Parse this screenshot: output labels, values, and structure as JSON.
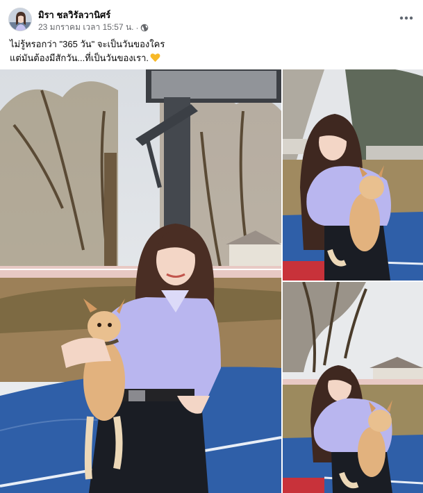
{
  "post": {
    "author": "มิรา ชลวิรัลวานิศร์",
    "timestamp": "23 มกราคม เวลา 15:57 น.",
    "separator": "·",
    "privacy_icon": "globe-icon",
    "more_icon": "more-horizontal-icon"
  },
  "caption": {
    "line1": "ไม่รู้หรอกว่า \"365 วัน\" จะเป็นวันของใคร",
    "line2": "แต่มันต้องมีสักวัน...ที่เป็นวันของเรา.",
    "emoji_icon": "yellow-heart-icon"
  },
  "photos": {
    "count": 3,
    "items": [
      {
        "icon": "photo-girl-holding-dog-basketball-court"
      },
      {
        "icon": "photo-girl-holding-dog-upper"
      },
      {
        "icon": "photo-girl-holding-dog-lower"
      }
    ]
  },
  "colors": {
    "text_primary": "#050505",
    "text_secondary": "#65676b",
    "heart": "#f7b928",
    "court_blue": "#2f5fa8",
    "court_red": "#c8323a",
    "shirt_lavender": "#b9b6ef"
  }
}
